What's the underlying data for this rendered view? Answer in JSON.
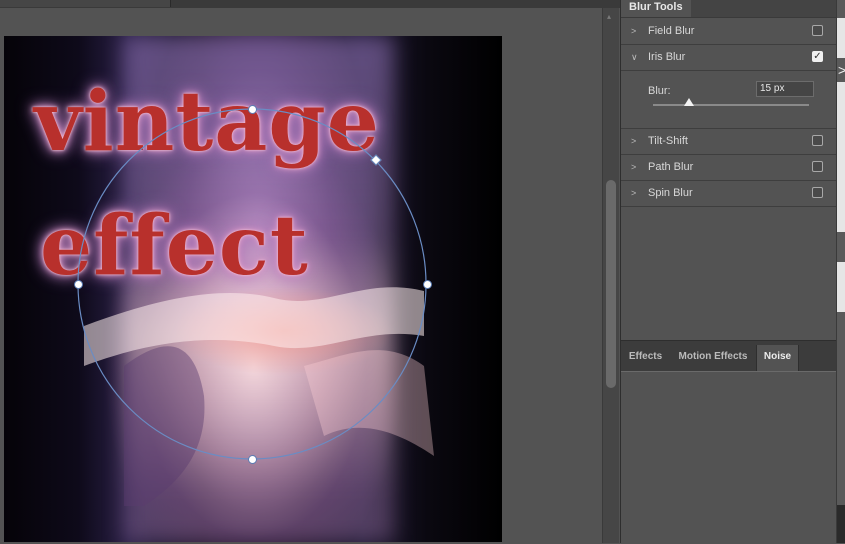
{
  "panel": {
    "title": "Blur Tools",
    "items": [
      {
        "label": "Field Blur",
        "checked": false,
        "expanded": false
      },
      {
        "label": "Iris Blur",
        "checked": true,
        "expanded": true
      },
      {
        "label": "Tilt-Shift",
        "checked": false,
        "expanded": false
      },
      {
        "label": "Path Blur",
        "checked": false,
        "expanded": false
      },
      {
        "label": "Spin Blur",
        "checked": false,
        "expanded": false
      }
    ],
    "iris": {
      "blur_label": "Blur:",
      "blur_value": "15 px",
      "slider_fraction": 0.23
    }
  },
  "effects_tabs": [
    {
      "label": "Effects",
      "active": false
    },
    {
      "label": "Motion Effects",
      "active": false
    },
    {
      "label": "Noise",
      "active": true
    }
  ],
  "artwork": {
    "line1": "vintage",
    "line2": "effect"
  },
  "icons": {
    "chevron_right": "chevron-right-icon",
    "chevron_down": "chevron-down-icon",
    "checkmark": "checkmark-icon",
    "cursor": "cursor-icon"
  },
  "colors": {
    "text_red": "#b8302c",
    "text_glow": "#e9a6cc",
    "iris_outline": "#5a7cb4",
    "panel_bg": "#535353"
  }
}
